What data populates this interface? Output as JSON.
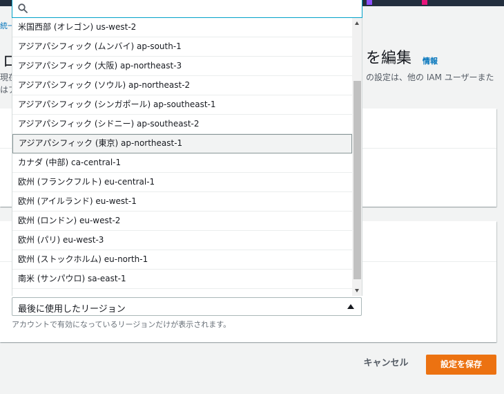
{
  "breadcrumb": {
    "label": "統一"
  },
  "header": {
    "title_left": "ロ",
    "title_right": "を編集",
    "info_link": "情報",
    "desc_left_line1": "現在",
    "desc_left_line2": "はア",
    "desc_right": "の設定は、他の IAM ユーザーまた"
  },
  "search": {
    "value": "",
    "placeholder": ""
  },
  "regions": [
    {
      "label": "米国西部 (オレゴン) us-west-2"
    },
    {
      "label": "アジアパシフィック (ムンバイ) ap-south-1"
    },
    {
      "label": "アジアパシフィック (大阪) ap-northeast-3"
    },
    {
      "label": "アジアパシフィック (ソウル) ap-northeast-2"
    },
    {
      "label": "アジアパシフィック (シンガポール) ap-southeast-1"
    },
    {
      "label": "アジアパシフィック (シドニー) ap-southeast-2"
    },
    {
      "label": "アジアパシフィック (東京) ap-northeast-1"
    },
    {
      "label": "カナダ (中部) ca-central-1"
    },
    {
      "label": "欧州 (フランクフルト) eu-central-1"
    },
    {
      "label": "欧州 (アイルランド) eu-west-1"
    },
    {
      "label": "欧州 (ロンドン) eu-west-2"
    },
    {
      "label": "欧州 (パリ) eu-west-3"
    },
    {
      "label": "欧州 (ストックホルム) eu-north-1"
    },
    {
      "label": "南米 (サンパウロ) sa-east-1"
    }
  ],
  "selected_index": 6,
  "select": {
    "value": "最後に使用したリージョン"
  },
  "helper_text": "アカウントで有効になっているリージョンだけが表示されます。",
  "buttons": {
    "cancel": "キャンセル",
    "save": "設定を保存"
  },
  "colors": {
    "accent": "#ec7211",
    "link": "#0073bb",
    "topbar": "#232f3e",
    "focus": "#00a1c9"
  },
  "icons": {
    "search": "search-icon",
    "caret": "caret-up-icon"
  }
}
